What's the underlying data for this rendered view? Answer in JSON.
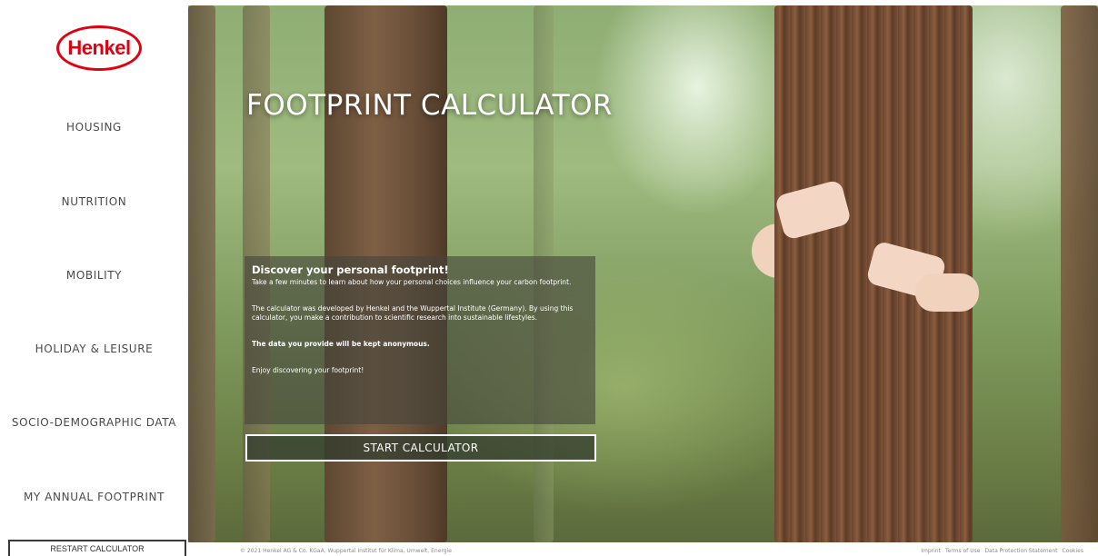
{
  "brand": {
    "logo_text": "Henkel",
    "color": "#e1000f"
  },
  "sidebar": {
    "items": [
      {
        "label": "HOUSING"
      },
      {
        "label": "NUTRITION"
      },
      {
        "label": "MOBILITY"
      },
      {
        "label": "HOLIDAY & LEISURE"
      },
      {
        "label": "SOCIO-DEMOGRAPHIC DATA"
      },
      {
        "label": "MY ANNUAL FOOTPRINT"
      }
    ],
    "restart_label": "RESTART CALCULATOR"
  },
  "hero": {
    "title": "FOOTPRINT CALCULATOR",
    "heading": "Discover your personal footprint!",
    "paragraphs": [
      "Take a few minutes to learn about how your personal choices influence your carbon footprint.",
      "The calculator was developed by Henkel and the Wuppertal Institute (Germany). By using this calculator, you make a contribution to scientific research into sustainable lifestyles.",
      "The data you provide will be kept anonymous.",
      "Enjoy discovering your footprint!"
    ],
    "start_label": "START CALCULATOR"
  },
  "footer": {
    "copyright": "© 2021 Henkel AG & Co. KGaA, Wuppertal Institut für Klima, Umwelt, Energie",
    "links": [
      "Imprint",
      "Terms of Use",
      "Data Protection Statement",
      "Cookies"
    ]
  }
}
